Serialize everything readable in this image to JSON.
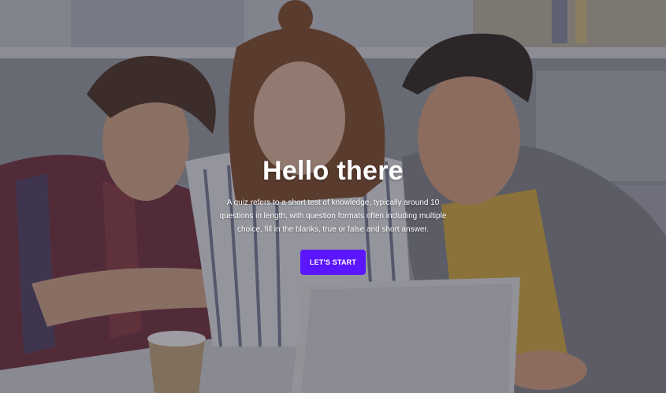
{
  "hero": {
    "title": "Hello there",
    "description": "A quiz refers to a short test of knowledge, typically around 10 questions in length, with question formats often including multiple choice, fill in the blanks, true or false and short answer.",
    "button_label": "LET'S START"
  },
  "colors": {
    "accent": "#5b16ff",
    "text": "#ffffff"
  }
}
